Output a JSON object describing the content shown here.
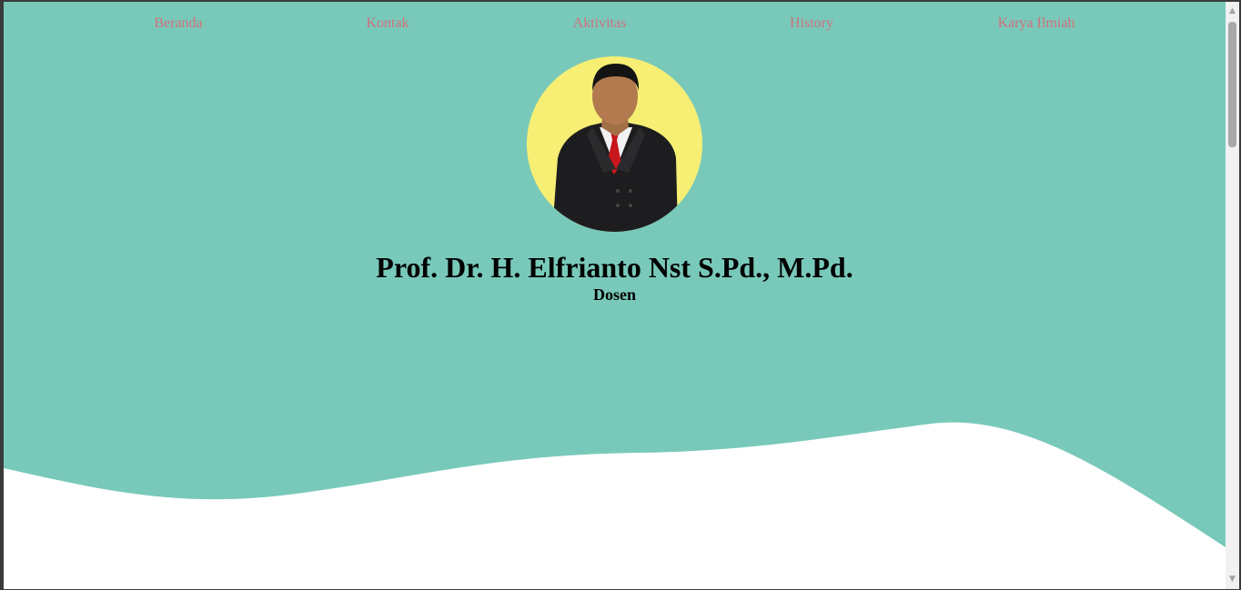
{
  "nav": {
    "items": [
      {
        "label": "Beranda"
      },
      {
        "label": "Kontak"
      },
      {
        "label": "Aktivitas"
      },
      {
        "label": "History"
      },
      {
        "label": "Karya Ilmiah"
      }
    ]
  },
  "profile": {
    "name": "Prof. Dr. H. Elfrianto Nst S.Pd., M.Pd.",
    "role": "Dosen"
  },
  "colors": {
    "background": "#79c9ba",
    "nav_link": "#d0707c",
    "avatar_bg": "#f6ef74",
    "wave": "#ffffff"
  }
}
